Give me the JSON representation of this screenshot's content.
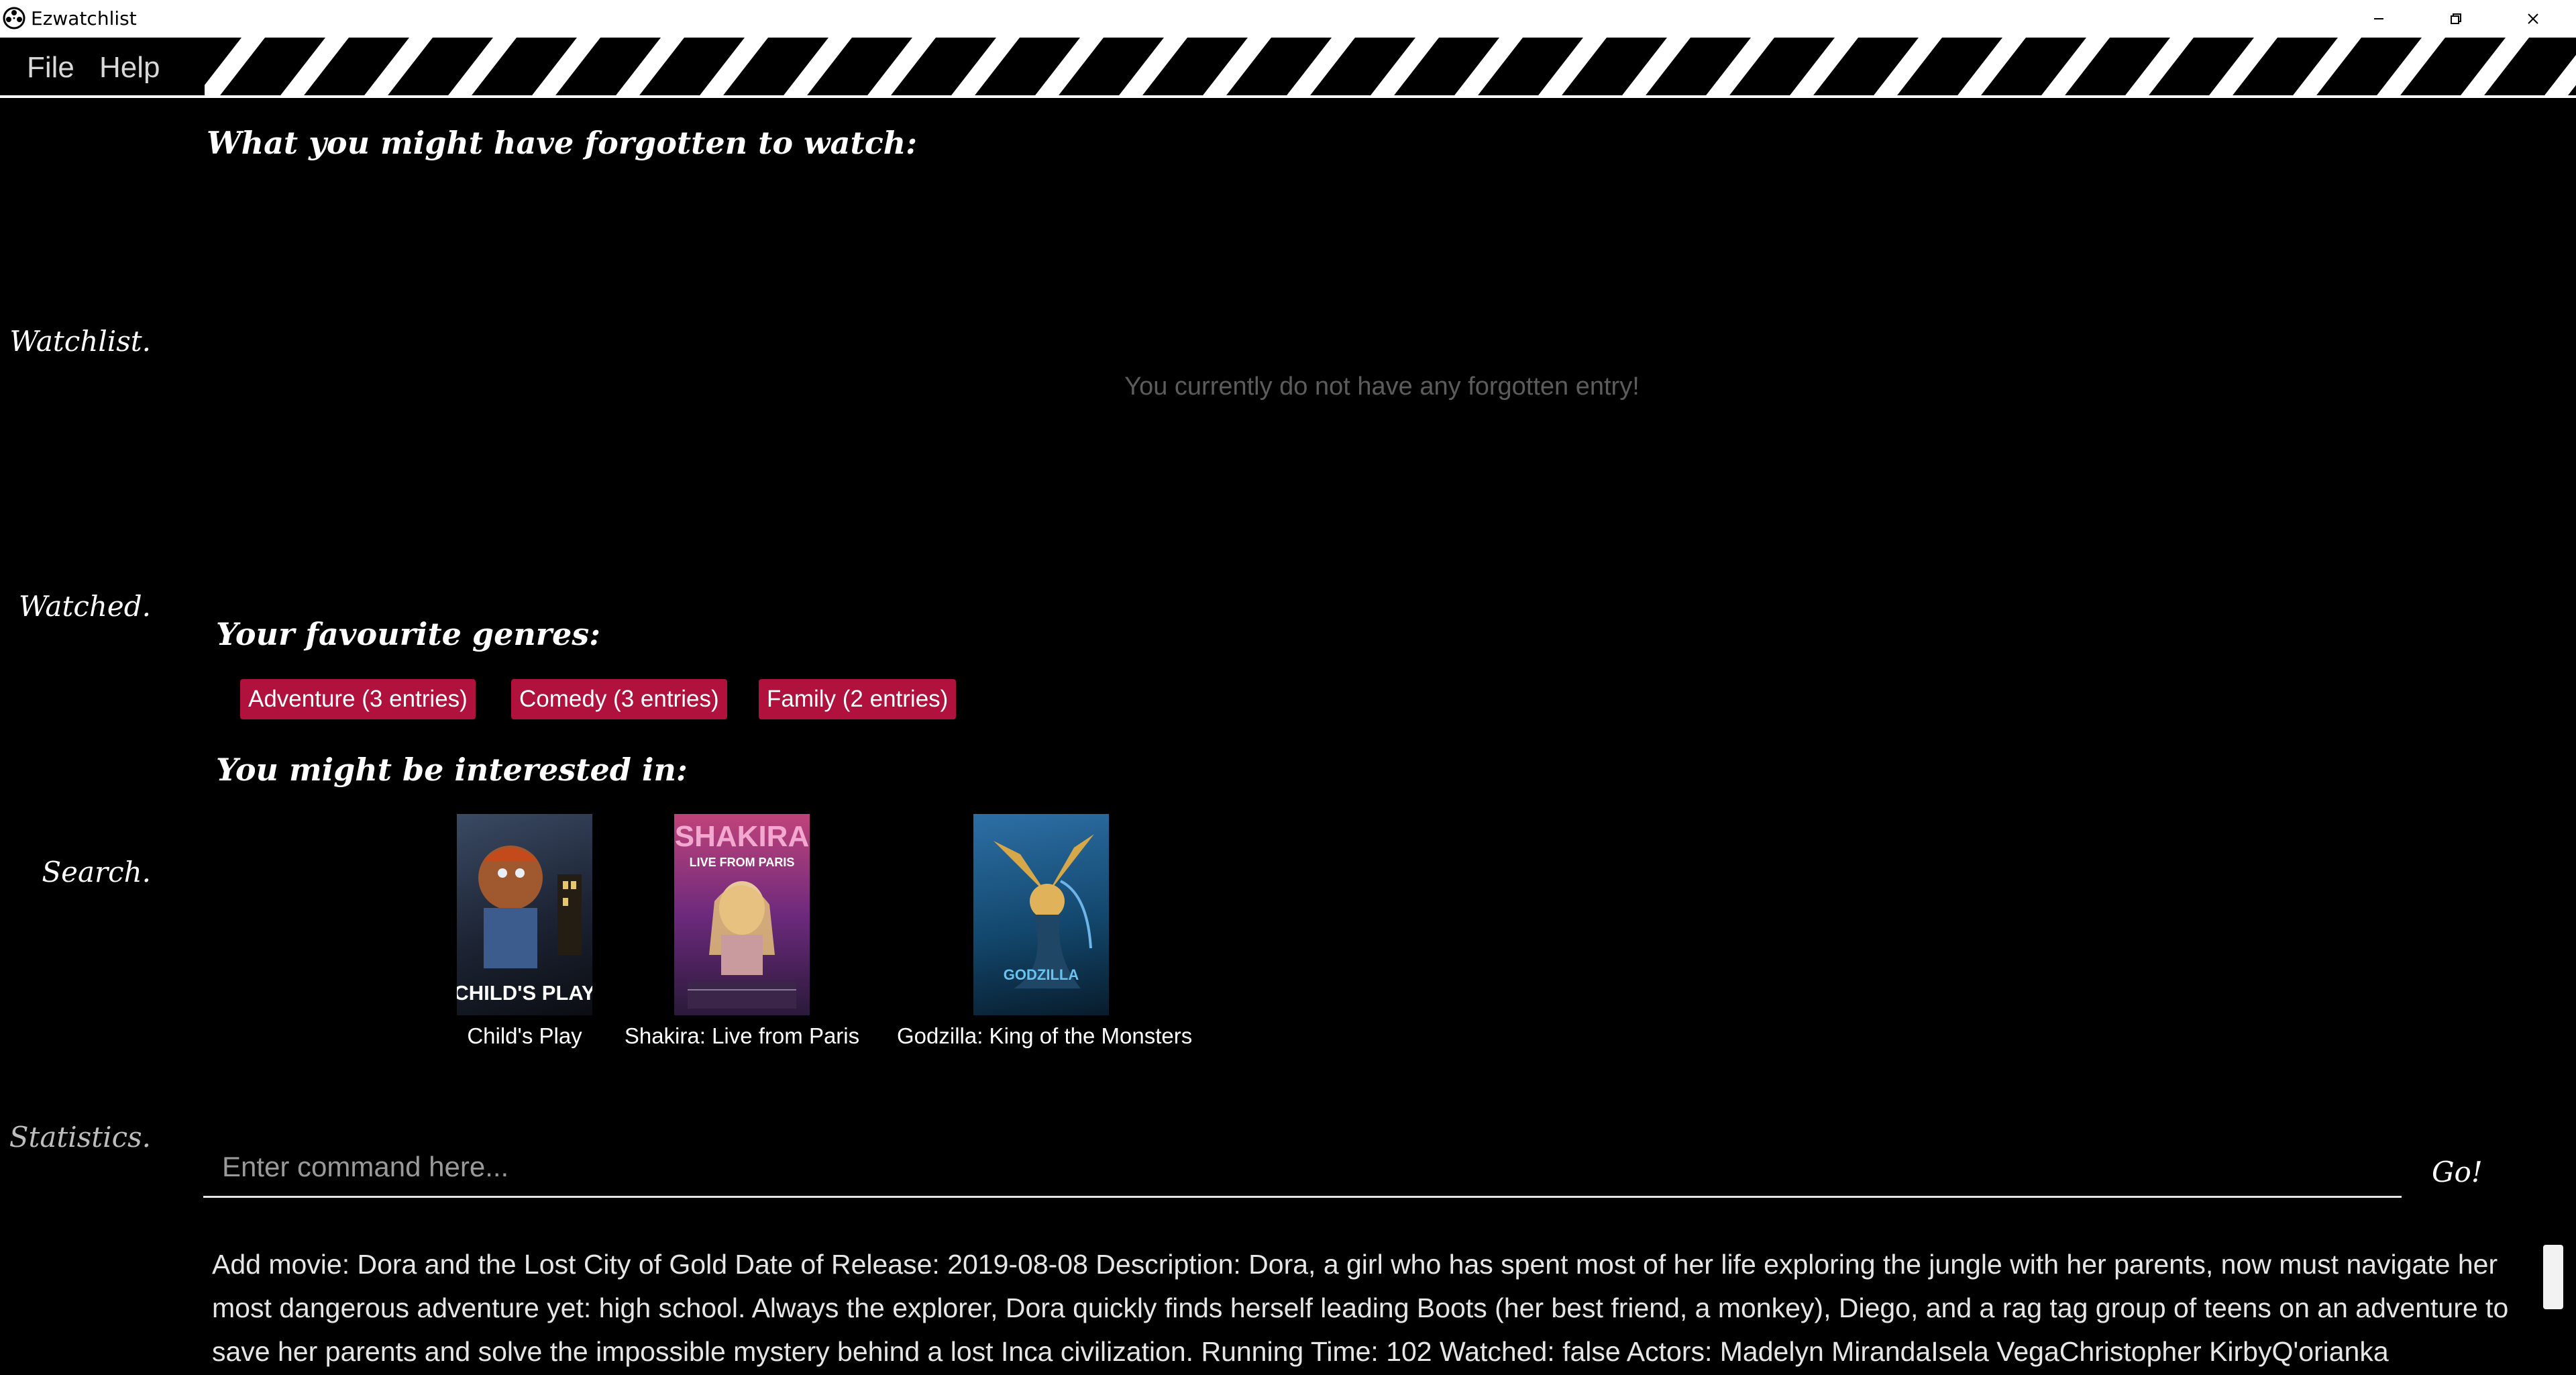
{
  "window": {
    "title": "Ezwatchlist",
    "controls": [
      "minimize-icon",
      "restore-icon",
      "close-icon"
    ]
  },
  "menu": {
    "items": [
      "File",
      "Help"
    ]
  },
  "sidebar": {
    "items": [
      {
        "label": "Watchlist."
      },
      {
        "label": "Watched."
      },
      {
        "label": "Search."
      },
      {
        "label": "Statistics."
      }
    ]
  },
  "main": {
    "forgotten_heading": "What you might have forgotten to watch:",
    "forgotten_empty": "You currently do not have any forgotten entry!",
    "genres_heading": "Your favourite genres:",
    "genres": [
      {
        "label": "Adventure (3 entries)"
      },
      {
        "label": "Comedy (3 entries)"
      },
      {
        "label": "Family (2 entries)"
      }
    ],
    "interested_heading": "You might be interested in:",
    "recommendations": [
      {
        "title": "Child's Play",
        "poster_text": "CHILD'S PLAY"
      },
      {
        "title": "Shakira: Live from Paris",
        "poster_text": "SHAKIRA",
        "poster_subtext": "LIVE FROM PARIS"
      },
      {
        "title": "Godzilla: King of the Monsters",
        "poster_text": "GODZILLA"
      }
    ]
  },
  "command": {
    "placeholder": "Enter command here...",
    "go_label": "Go!"
  },
  "result": {
    "text": "Add movie: Dora and the Lost City of Gold Date of Release: 2019-08-08 Description: Dora, a girl who has spent most of her life exploring the jungle with her parents, now must navigate her most dangerous adventure yet: high school. Always the explorer, Dora quickly finds herself leading Boots (her best friend, a monkey), Diego, and a rag tag group of teens on an adventure to save her parents and solve the impossible mystery behind a lost Inca civilization. Running Time: 102 Watched: false Actors: Madelyn MirandaIsela VegaChristopher KirbyQ'orianka KilcherEva"
  },
  "colors": {
    "genre_tag": "#b0113d",
    "background": "#000000",
    "muted_text": "#5c5c5c"
  }
}
